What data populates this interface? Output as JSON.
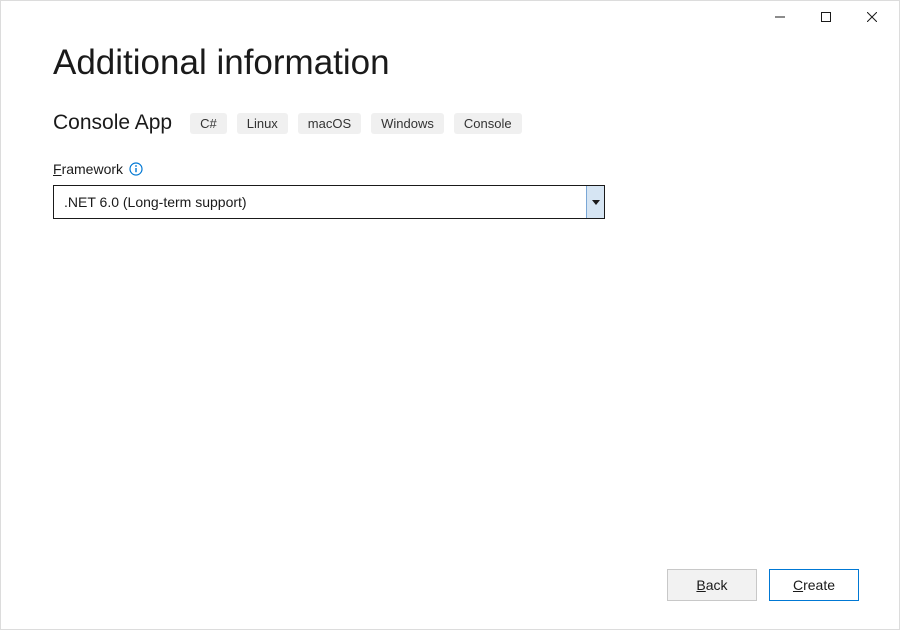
{
  "header": {
    "title": "Additional information",
    "subtitle": "Console App",
    "tags": [
      "C#",
      "Linux",
      "macOS",
      "Windows",
      "Console"
    ]
  },
  "framework": {
    "label": "Framework",
    "selected": ".NET 6.0 (Long-term support)"
  },
  "footer": {
    "back_label": "Back",
    "create_label": "Create"
  }
}
